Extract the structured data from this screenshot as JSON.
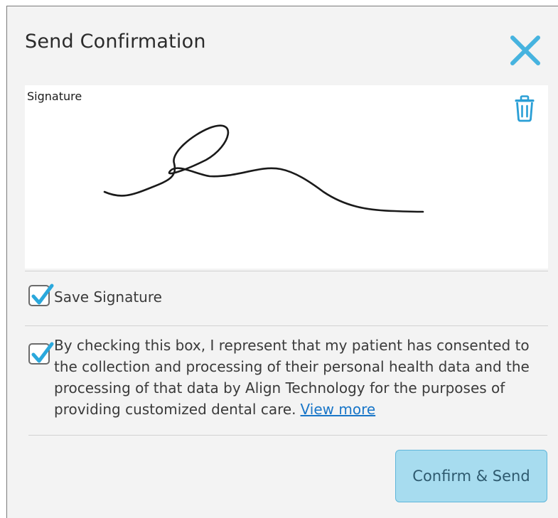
{
  "dialog": {
    "title": "Send Confirmation",
    "close_icon": "close-icon"
  },
  "signature": {
    "label": "Signature",
    "delete_icon": "trash-icon"
  },
  "save_signature": {
    "checked": true,
    "label": "Save Signature"
  },
  "consent": {
    "checked": true,
    "text": "By checking this box, I represent that my patient has consented to the collection and processing of their personal health data and the processing of that data by Align Technology for the purposes of providing customized dental care.",
    "link_label": "View more"
  },
  "actions": {
    "confirm_label": "Confirm & Send"
  },
  "colors": {
    "accent": "#2aa8dc",
    "button_bg": "#a7dcef",
    "link": "#1976c8"
  }
}
